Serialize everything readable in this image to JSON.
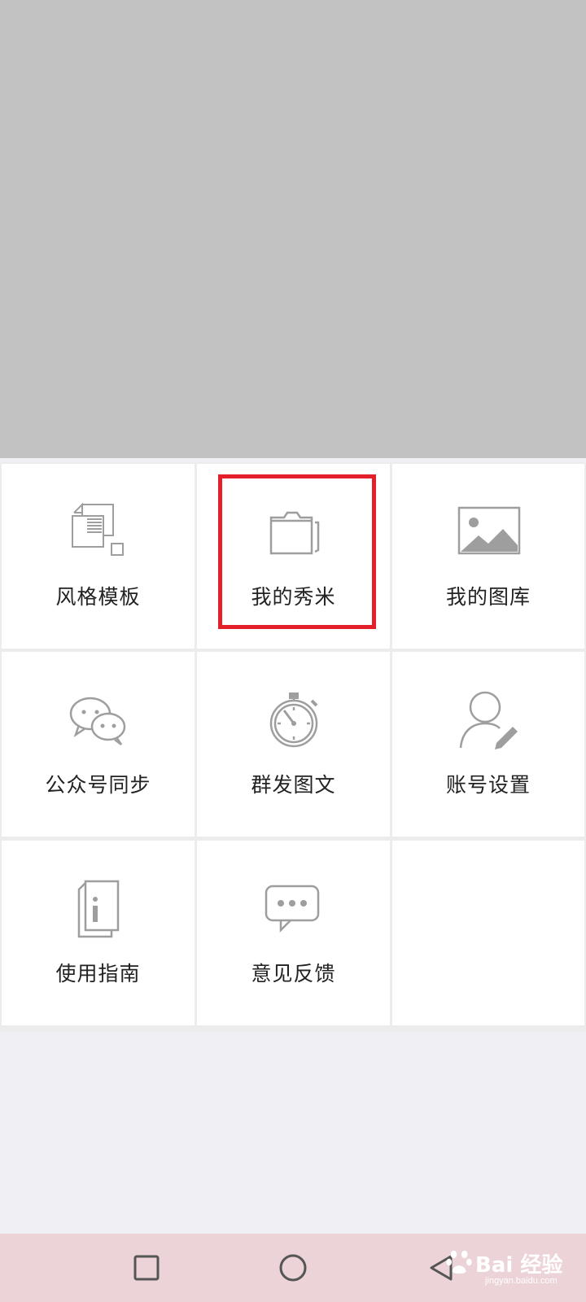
{
  "menu": {
    "items": [
      {
        "label": "风格模板",
        "icon": "template-icon"
      },
      {
        "label": "我的秀米",
        "icon": "folder-icon"
      },
      {
        "label": "我的图库",
        "icon": "image-gallery-icon"
      },
      {
        "label": "公众号同步",
        "icon": "wechat-icon"
      },
      {
        "label": "群发图文",
        "icon": "stopwatch-icon"
      },
      {
        "label": "账号设置",
        "icon": "user-edit-icon"
      },
      {
        "label": "使用指南",
        "icon": "info-book-icon"
      },
      {
        "label": "意见反馈",
        "icon": "feedback-chat-icon"
      }
    ],
    "highlighted": "我的秀米"
  },
  "navbar": {
    "buttons": [
      "recent-apps-button",
      "home-button",
      "back-button"
    ]
  },
  "watermark": {
    "brand": "Bai  经验",
    "url": "jingyan.baidu.com"
  },
  "colors": {
    "highlight_border": "#e3202a",
    "icon_gray": "#9e9e9e",
    "top_area": "#c2c2c2",
    "navbar": "#ecd3d7"
  }
}
